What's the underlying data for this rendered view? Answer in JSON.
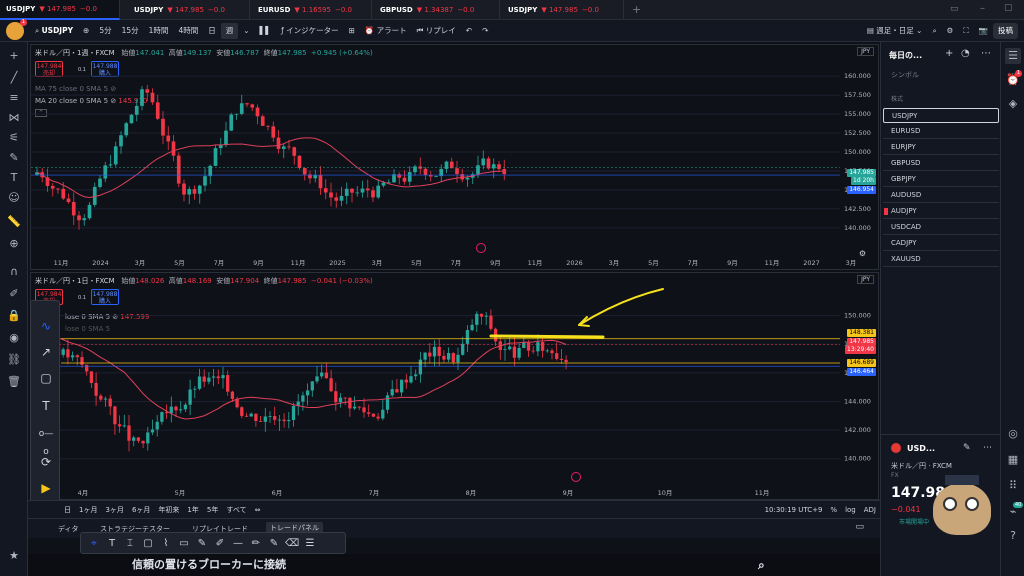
{
  "tabs": [
    {
      "sym": "USDJPY",
      "price": "▼ 147.985",
      "chg": "−0.0",
      "active": true
    },
    {
      "sym": "USDJPY",
      "price": "▼ 147.985",
      "chg": "−0.0",
      "active": false
    },
    {
      "sym": "EURUSD",
      "price": "▼ 1.16595",
      "chg": "−0.0",
      "active": false
    },
    {
      "sym": "GBPUSD",
      "price": "▼ 1.34387",
      "chg": "−0.0",
      "active": false
    },
    {
      "sym": "USDJPY",
      "price": "▼ 147.985",
      "chg": "−0.0",
      "active": false
    }
  ],
  "toolbar": {
    "symbol": "USDJPY",
    "intervals": [
      "5分",
      "15分",
      "1時間",
      "4時間",
      "日",
      "週"
    ],
    "selected": "週",
    "indicators": "インジケーター",
    "alert": "アラート",
    "replay": "リプレイ",
    "timeframe": "週足・日足",
    "publish": "投稿"
  },
  "top_chart": {
    "title": "米ドル／円・1週・FXCM",
    "ohlc": {
      "o_label": "始値",
      "o": "147.041",
      "h_label": "高値",
      "h": "149.137",
      "l_label": "安値",
      "l": "146.787",
      "c_label": "終値",
      "c": "147.985",
      "chg": "+0.945 (+0.64%)"
    },
    "sell": {
      "price": "147.984",
      "label": "売却"
    },
    "spread": "0.1",
    "buy": {
      "price": "147.988",
      "label": "購入"
    },
    "ma75": "MA 75 close 0 SMA 5",
    "ma20": "MA 20 close 0 SMA 5",
    "ma20_val": "145.910",
    "currency": "JPY",
    "yticks": [
      "160.000",
      "157.500",
      "155.000",
      "152.500",
      "150.000",
      "147.500",
      "145.000",
      "142.500",
      "140.000"
    ],
    "ytags": {
      "last": "147.985",
      "countdown": "1d 20h",
      "ma": "146.954"
    },
    "xticks": [
      "11月",
      "2024",
      "3月",
      "5月",
      "7月",
      "9月",
      "11月",
      "2025",
      "3月",
      "5月",
      "7月",
      "9月",
      "11月",
      "2026",
      "3月",
      "5月",
      "7月",
      "9月",
      "11月",
      "2027",
      "3月"
    ]
  },
  "bottom_chart": {
    "title": "米ドル／円・1日・FXCM",
    "ohlc": {
      "o_label": "始値",
      "o": "148.026",
      "h_label": "高値",
      "h": "148.169",
      "l_label": "安値",
      "l": "147.904",
      "c_label": "終値",
      "c": "147.985",
      "chg": "−0.041 (−0.03%)"
    },
    "sell": {
      "price": "147.984",
      "label": "売却"
    },
    "spread": "0.1",
    "buy": {
      "price": "147.988",
      "label": "購入"
    },
    "ma_partial": "lose 0 SMA 5",
    "ma_prefix": "lose 0 SMA 5",
    "ma_val": "147.599",
    "currency": "JPY",
    "yticks": [
      "150.000",
      "148.000",
      "146.000",
      "144.000",
      "142.000",
      "140.000"
    ],
    "ytags": {
      "upper": "148.381",
      "last": "147.985",
      "countdown": "13:29:40",
      "lower": "146.689",
      "ma": "146.464"
    },
    "xticks": [
      "4月",
      "5月",
      "6月",
      "7月",
      "8月",
      "9月",
      "10月",
      "11月"
    ]
  },
  "bottombar": {
    "ranges": [
      "日",
      "1ヶ月",
      "3ヶ月",
      "6ヶ月",
      "年初来",
      "1年",
      "5年",
      "すべて"
    ],
    "clock": "10:30:19 UTC+9",
    "adj": "ADJ"
  },
  "panelbar": {
    "tabs": [
      "ディタ",
      "ストラテジーテスター",
      "リプレイトレード",
      "トレードパネル"
    ]
  },
  "subtitle": "信頼の置けるブローカーに接続",
  "watchlist": {
    "title": "毎日の...",
    "symbol_header": "シンボル",
    "section": "株式",
    "items": [
      "USDJPY",
      "EURUSD",
      "EURJPY",
      "GBPUSD",
      "GBPJPY",
      "AUDUSD",
      "AUDJPY",
      "USDCAD",
      "CADJPY",
      "XAUUSD"
    ],
    "selected": "USDJPY",
    "flagged": "AUDJPY"
  },
  "details": {
    "symbol": "USD...",
    "name": "米ドル／円",
    "exchange": "FXCM",
    "type": "FX",
    "price": "147.98",
    "change": "−0.041",
    "status": "市場開場中"
  },
  "badges": {
    "alerts": "1",
    "notifications": "40"
  },
  "colors": {
    "up": "#26a69a",
    "down": "#f23645",
    "accent": "#2962ff",
    "annotation": "#f5e11c"
  }
}
